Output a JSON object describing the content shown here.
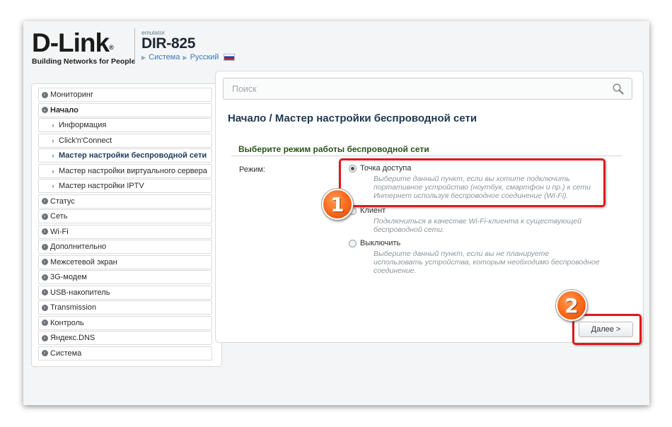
{
  "header": {
    "logo_text": "D-Link",
    "logo_tagline": "Building Networks for People",
    "emulator_label": "emulator",
    "model": "DIR-825",
    "crumb_system": "Система",
    "crumb_language": "Русский"
  },
  "sidebar": {
    "items": [
      {
        "label": "Мониторинг"
      },
      {
        "label": "Начало"
      },
      {
        "label": "Информация"
      },
      {
        "label": "Click'n'Connect"
      },
      {
        "label": "Мастер настройки беспроводной сети"
      },
      {
        "label": "Мастер настройки виртуального сервера"
      },
      {
        "label": "Мастер настройки IPTV"
      },
      {
        "label": "Статус"
      },
      {
        "label": "Сеть"
      },
      {
        "label": "Wi-Fi"
      },
      {
        "label": "Дополнительно"
      },
      {
        "label": "Межсетевой экран"
      },
      {
        "label": "3G-модем"
      },
      {
        "label": "USB-накопитель"
      },
      {
        "label": "Transmission"
      },
      {
        "label": "Контроль"
      },
      {
        "label": "Яндекс.DNS"
      },
      {
        "label": "Система"
      }
    ]
  },
  "search": {
    "placeholder": "Поиск"
  },
  "main": {
    "page_title": "Начало /  Мастер настройки беспроводной сети",
    "section_title": "Выберите режим работы беспроводной сети",
    "mode_label": "Режим:",
    "options": [
      {
        "label": "Точка доступа",
        "selected": true,
        "desc": "Выберите данный пункт, если вы хотите подключить портативное устройство (ноутбук, смартфон и пр.) к сети Интернет используя беспроводное соединение (Wi-Fi)."
      },
      {
        "label": "Клиент",
        "selected": false,
        "desc": "Подключиться в качестве Wi-Fi-клиента к существующей беспроводной сети."
      },
      {
        "label": "Выключить",
        "selected": false,
        "desc": "Выберите данный пункт, если вы не планируете использовать устройства, которым необходимо беспроводное соединение."
      }
    ],
    "next_button": "Далее >"
  },
  "annotations": {
    "badge1": "1",
    "badge2": "2",
    "highlight_color": "#e0191e",
    "badge_color": "#ff6f1e"
  },
  "colors": {
    "section_title": "#2a5418",
    "link": "#3a79b8",
    "page_title": "#1d3850"
  }
}
